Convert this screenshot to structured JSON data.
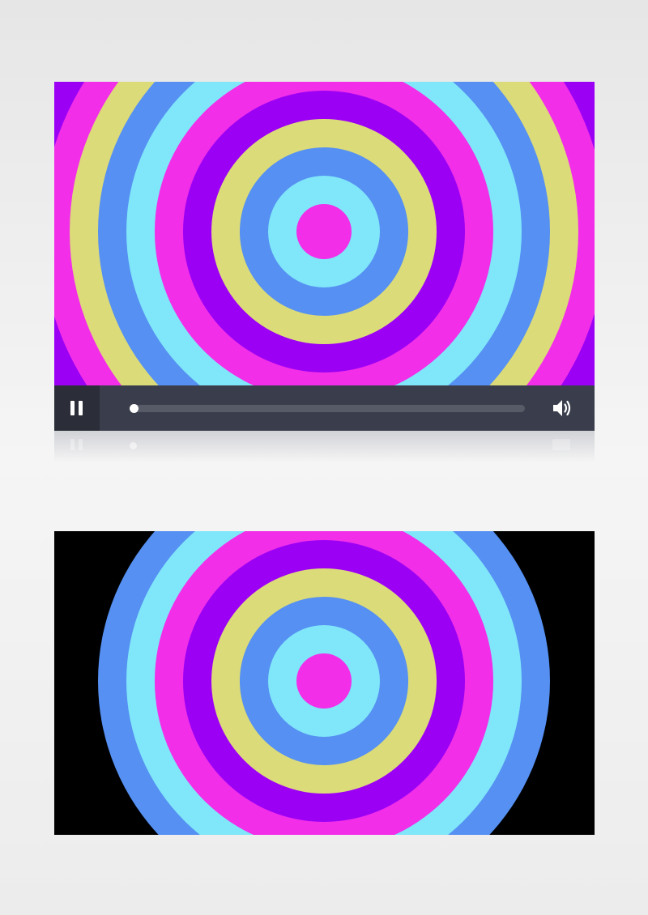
{
  "player": {
    "state": "playing",
    "progress": 0.0,
    "pause_icon": "pause-icon",
    "volume_icon": "volume-high-icon",
    "video": {
      "rings_outer_to_inner": [
        "#9b00f5",
        "#f22ee8",
        "#dcdb79",
        "#5590f2",
        "#80e6f9",
        "#f22ee8",
        "#9b00f5",
        "#dcdb79",
        "#5590f2",
        "#80e6f9",
        "#f22ee8"
      ],
      "background": "#f22ee8"
    },
    "controls": {
      "bar_color": "#3a3e4c",
      "play_button_bg": "#2b2e38",
      "track_color": "#575b68",
      "thumb_color": "#ffffff"
    }
  },
  "still_frame": {
    "background": "#000000",
    "rings_outer_to_inner": [
      "#5590f2",
      "#80e6f9",
      "#f22ee8",
      "#9b00f5",
      "#dcdb79",
      "#5590f2",
      "#80e6f9",
      "#f22ee8"
    ]
  }
}
